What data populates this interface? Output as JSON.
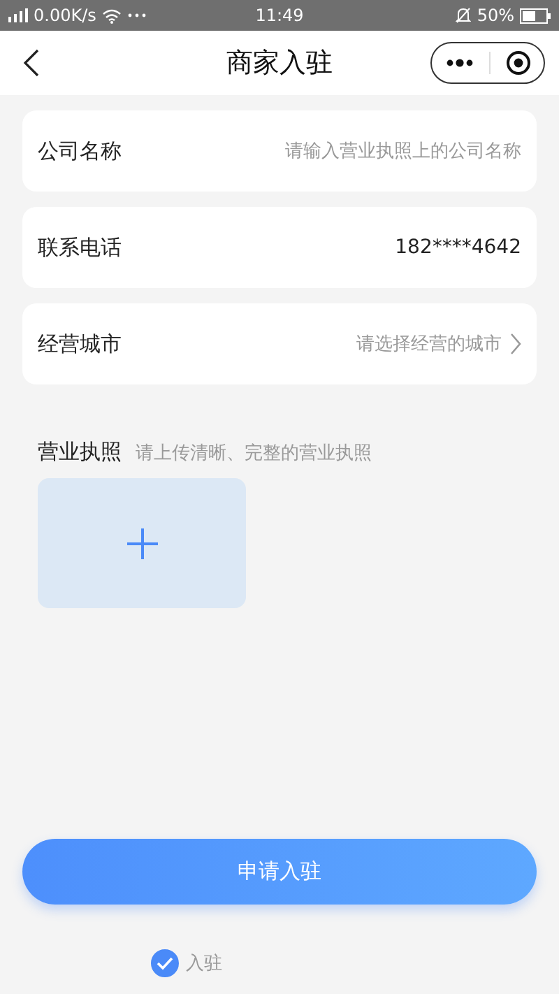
{
  "status_bar": {
    "network": "0.00K/s",
    "time": "11:49",
    "battery": "50%"
  },
  "nav": {
    "title": "商家入驻"
  },
  "form": [
    {
      "kind": "input",
      "label": "公司名称",
      "placeholder": "请输入营业执照上的公司名称"
    },
    {
      "kind": "value",
      "label": "联系电话",
      "value": "182****4642"
    },
    {
      "kind": "select",
      "label": "经营城市",
      "placeholder": "请选择经营的城市"
    }
  ],
  "license": {
    "label": "营业执照",
    "hint": "请上传清晰、完整的营业执照"
  },
  "submit": "申请入驻",
  "agreement": {
    "checked": true,
    "text": "入驻"
  }
}
